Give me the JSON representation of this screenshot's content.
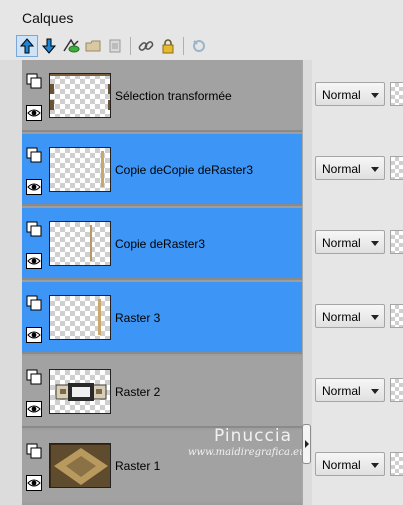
{
  "panel": {
    "title": "Calques"
  },
  "toolbar": {
    "icons": [
      "move-layer-up-icon",
      "move-layer-down-icon",
      "new-layer-icon",
      "folder-icon",
      "delete-layer-icon",
      "link-icon",
      "lock-icon",
      "edit-icon"
    ]
  },
  "layers": [
    {
      "name": "Sélection transformée",
      "blend": "Normal",
      "selected": false
    },
    {
      "name": "Copie deCopie deRaster3",
      "blend": "Normal",
      "selected": true
    },
    {
      "name": "Copie deRaster3",
      "blend": "Normal",
      "selected": true
    },
    {
      "name": "Raster 3",
      "blend": "Normal",
      "selected": true
    },
    {
      "name": "Raster 2",
      "blend": "Normal",
      "selected": false
    },
    {
      "name": "Raster 1",
      "blend": "Normal",
      "selected": false
    }
  ],
  "watermark": {
    "line1": "Pinuccia",
    "line2": "www.maidiregrafica.eu"
  },
  "colors": {
    "selection": "#3d96f5",
    "row_bg": "#a2a2a2",
    "accent_gold": "#c9a86a"
  }
}
